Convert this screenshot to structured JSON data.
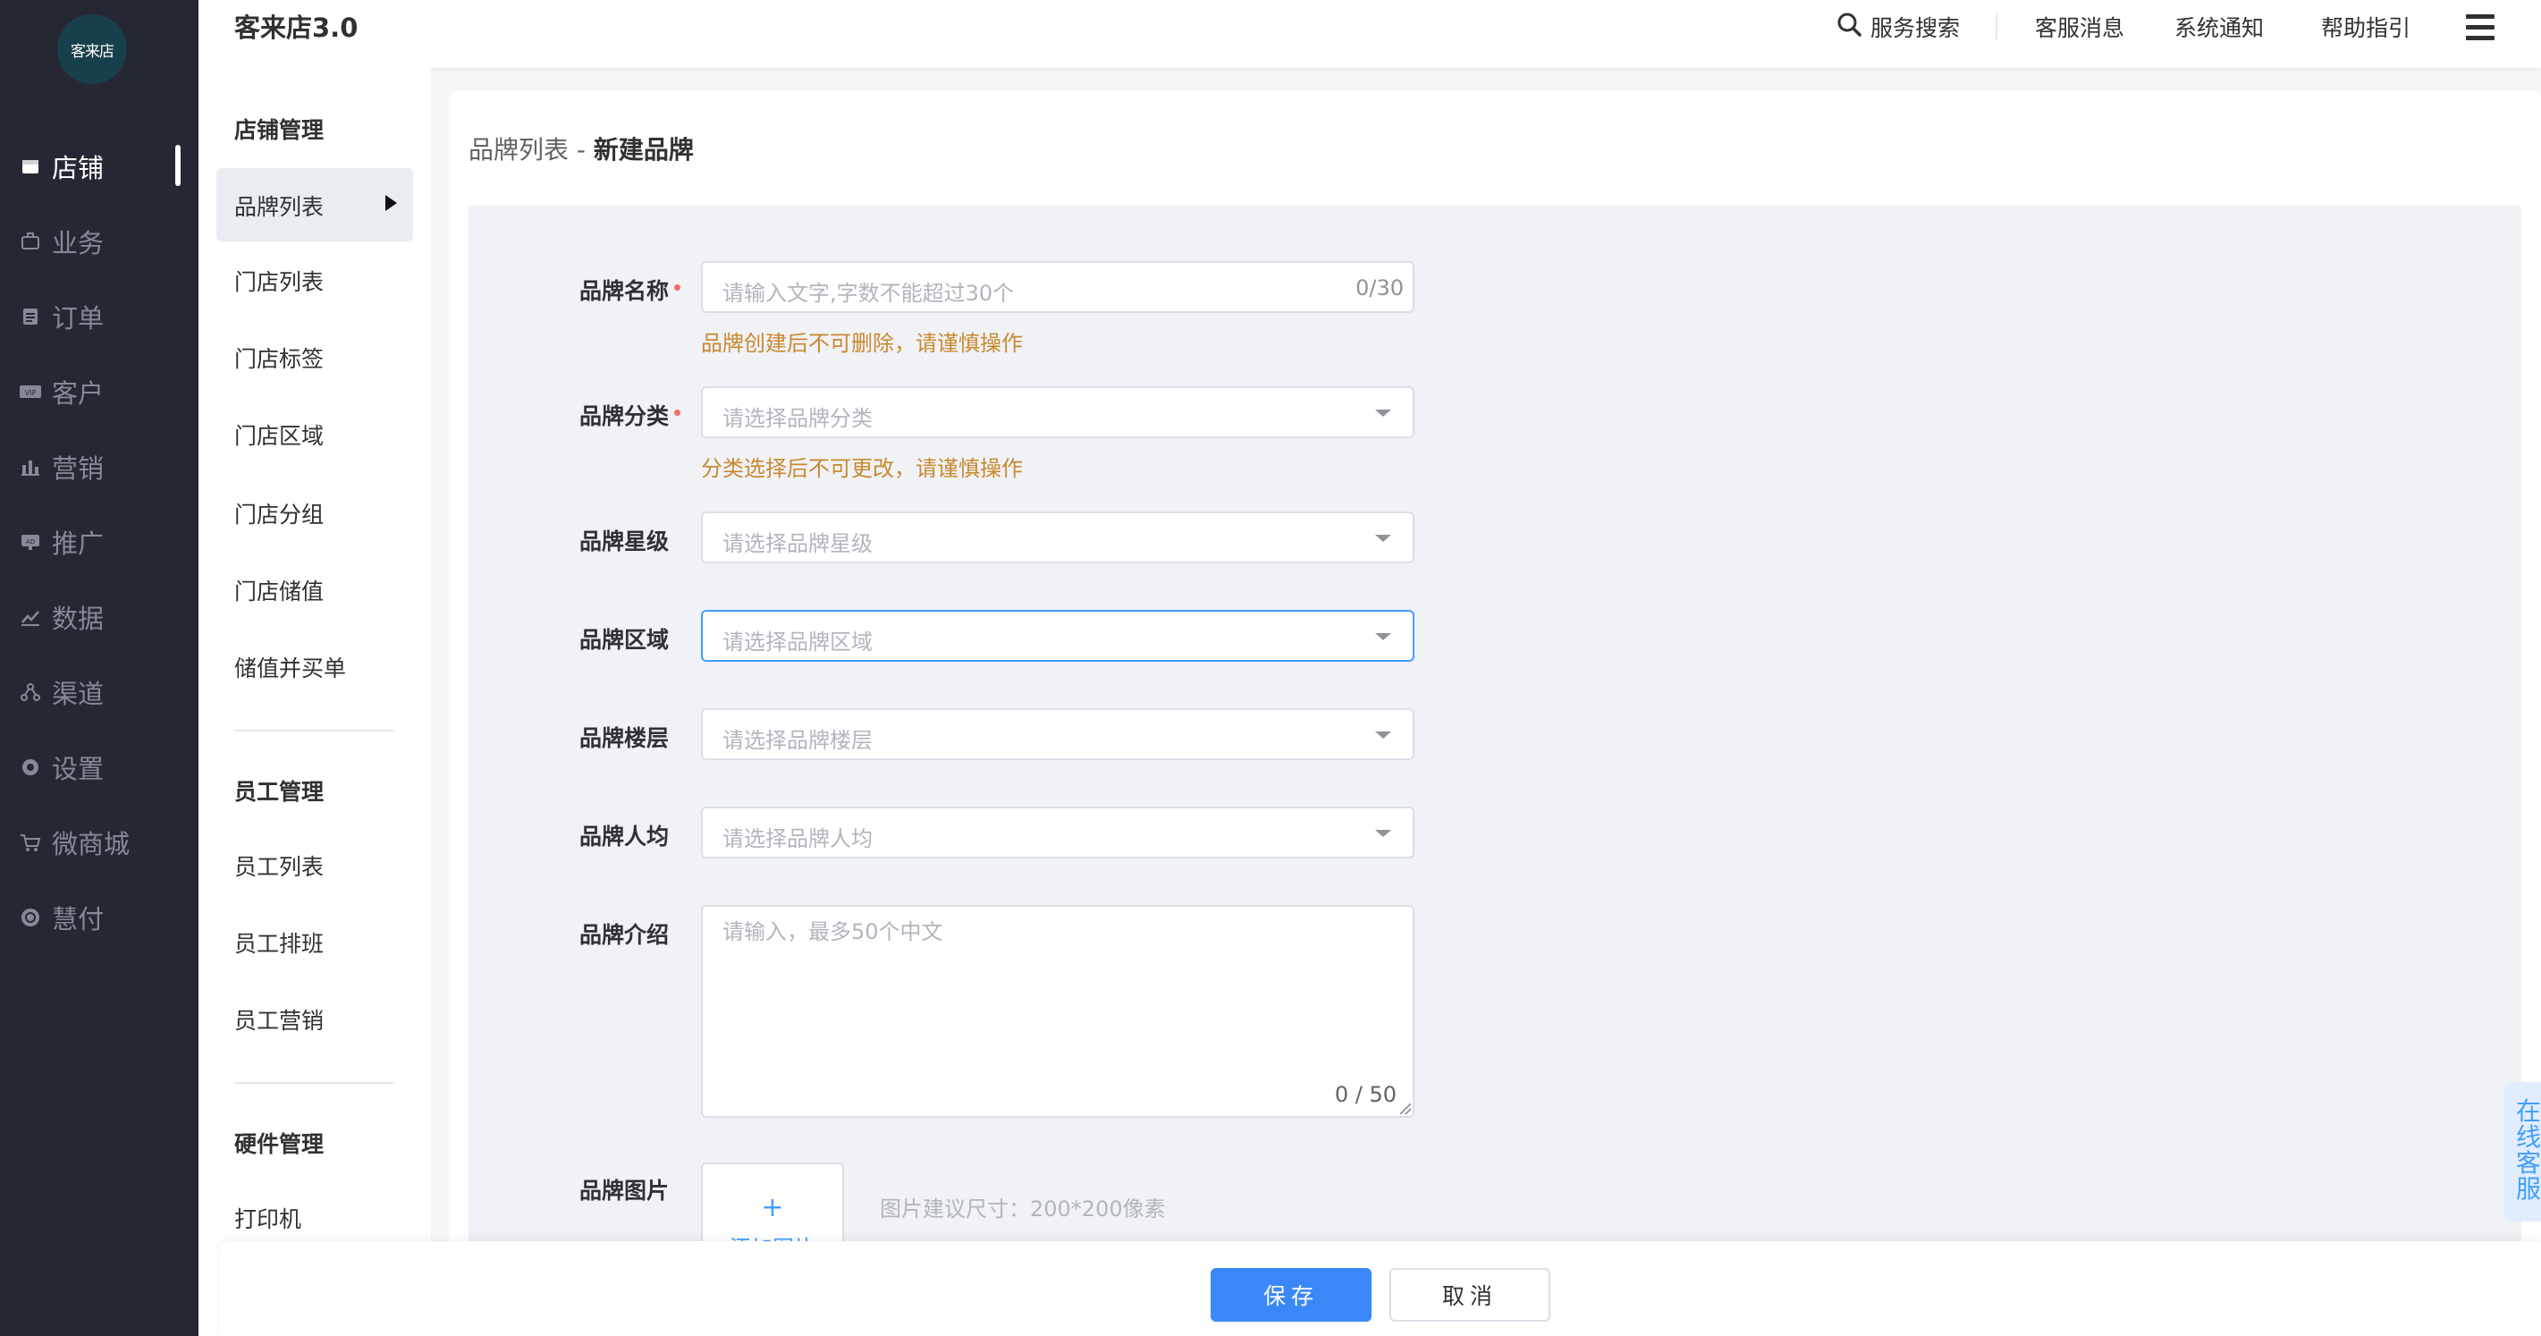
{
  "app": {
    "title": "客来店3.0",
    "logo_text": "客来店"
  },
  "leftnav": {
    "items": [
      {
        "label": "店铺",
        "icon": "store-icon",
        "active": true
      },
      {
        "label": "业务",
        "icon": "briefcase-icon"
      },
      {
        "label": "订单",
        "icon": "order-icon"
      },
      {
        "label": "客户",
        "icon": "vip-icon"
      },
      {
        "label": "营销",
        "icon": "bar-chart-icon"
      },
      {
        "label": "推广",
        "icon": "ad-icon"
      },
      {
        "label": "数据",
        "icon": "line-chart-icon"
      },
      {
        "label": "渠道",
        "icon": "channel-icon"
      },
      {
        "label": "设置",
        "icon": "gear-icon"
      },
      {
        "label": "微商城",
        "icon": "cart-icon"
      },
      {
        "label": "慧付",
        "icon": "coin-icon"
      }
    ]
  },
  "header": {
    "search_label": "服务搜索",
    "links": [
      "客服消息",
      "系统通知",
      "帮助指引"
    ]
  },
  "subnav": {
    "groups": [
      {
        "title": "店铺管理",
        "items": [
          "品牌列表",
          "门店列表",
          "门店标签",
          "门店区域",
          "门店分组",
          "门店储值",
          "储值并买单"
        ]
      },
      {
        "title": "员工管理",
        "items": [
          "员工列表",
          "员工排班",
          "员工营销"
        ]
      },
      {
        "title": "硬件管理",
        "items": [
          "打印机"
        ]
      }
    ],
    "active_item": "品牌列表"
  },
  "breadcrumb": {
    "parent": "品牌列表",
    "sep": " - ",
    "current": "新建品牌"
  },
  "form": {
    "name": {
      "label": "品牌名称",
      "placeholder": "请输入文字,字数不能超过30个",
      "counter": "0/30",
      "warning": "品牌创建后不可删除，请谨慎操作"
    },
    "category": {
      "label": "品牌分类",
      "placeholder": "请选择品牌分类",
      "warning": "分类选择后不可更改，请谨慎操作"
    },
    "stars": {
      "label": "品牌星级",
      "placeholder": "请选择品牌星级"
    },
    "region": {
      "label": "品牌区域",
      "placeholder": "请选择品牌区域"
    },
    "floor": {
      "label": "品牌楼层",
      "placeholder": "请选择品牌楼层"
    },
    "avg_price": {
      "label": "品牌人均",
      "placeholder": "请选择品牌人均"
    },
    "intro": {
      "label": "品牌介绍",
      "placeholder": "请输入，最多50个中文",
      "counter": "0 / 50"
    },
    "image": {
      "label": "品牌图片",
      "plus": "+",
      "add_text": "添加图片",
      "hint": "图片建议尺寸：200*200像素"
    }
  },
  "footer": {
    "save": "保存",
    "cancel": "取消"
  },
  "float_service": {
    "text": "在线客服"
  },
  "colors": {
    "accent": "#3a87f7",
    "sidebar_bg": "#252833",
    "warning": "#c8892e",
    "required": "#f56c6c"
  }
}
